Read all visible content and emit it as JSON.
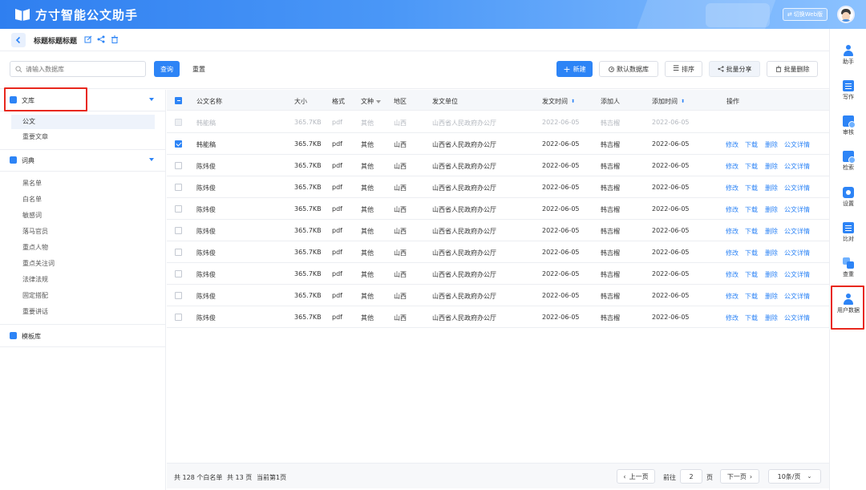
{
  "header": {
    "app_title": "方寸智能公文助手",
    "switch_label": "切换Web版"
  },
  "titlebar": {
    "title": "标题标题标题"
  },
  "toolbar": {
    "search_placeholder": "请输入数据库",
    "query_label": "查询",
    "reset_label": "重置",
    "new_label": "新建",
    "default_db_label": "默认数据库",
    "sort_label": "排序",
    "batch_share_label": "批量分享",
    "batch_delete_label": "批量删除"
  },
  "sidebar": {
    "library": {
      "label": "文库",
      "items": [
        "公文",
        "重要文章"
      ]
    },
    "dictionary": {
      "label": "词典",
      "items": [
        "黑名单",
        "白名单",
        "敏感词",
        "落马官员",
        "重点人物",
        "重点关注词",
        "法律法规",
        "固定搭配",
        "重要讲话"
      ]
    },
    "template": {
      "label": "模板库"
    }
  },
  "table": {
    "headers": {
      "name": "公文名称",
      "size": "大小",
      "format": "格式",
      "type": "文种",
      "region": "地区",
      "unit": "发文单位",
      "send_time": "发文时间",
      "adder": "添加人",
      "add_time": "添加时间",
      "ops": "操作"
    },
    "ops": {
      "edit": "修改",
      "download": "下载",
      "delete": "删除",
      "detail": "公文详情"
    },
    "rows": [
      {
        "name": "韩能稿",
        "size": "365.7KB",
        "format": "pdf",
        "type": "其他",
        "region": "山西",
        "unit": "山西省人民政府办公厅",
        "send_time": "2022-06-05",
        "adder": "韩吉榴",
        "add_time": "2022-06-05",
        "state": "disabled"
      },
      {
        "name": "韩能稿",
        "size": "365.7KB",
        "format": "pdf",
        "type": "其他",
        "region": "山西",
        "unit": "山西省人民政府办公厅",
        "send_time": "2022-06-05",
        "adder": "韩吉榴",
        "add_time": "2022-06-05",
        "state": "checked"
      },
      {
        "name": "陈炜俊",
        "size": "365.7KB",
        "format": "pdf",
        "type": "其他",
        "region": "山西",
        "unit": "山西省人民政府办公厅",
        "send_time": "2022-06-05",
        "adder": "韩吉榴",
        "add_time": "2022-06-05",
        "state": "normal"
      },
      {
        "name": "陈炜俊",
        "size": "365.7KB",
        "format": "pdf",
        "type": "其他",
        "region": "山西",
        "unit": "山西省人民政府办公厅",
        "send_time": "2022-06-05",
        "adder": "韩吉榴",
        "add_time": "2022-06-05",
        "state": "normal"
      },
      {
        "name": "陈炜俊",
        "size": "365.7KB",
        "format": "pdf",
        "type": "其他",
        "region": "山西",
        "unit": "山西省人民政府办公厅",
        "send_time": "2022-06-05",
        "adder": "韩吉榴",
        "add_time": "2022-06-05",
        "state": "normal"
      },
      {
        "name": "陈炜俊",
        "size": "365.7KB",
        "format": "pdf",
        "type": "其他",
        "region": "山西",
        "unit": "山西省人民政府办公厅",
        "send_time": "2022-06-05",
        "adder": "韩吉榴",
        "add_time": "2022-06-05",
        "state": "normal"
      },
      {
        "name": "陈炜俊",
        "size": "365.7KB",
        "format": "pdf",
        "type": "其他",
        "region": "山西",
        "unit": "山西省人民政府办公厅",
        "send_time": "2022-06-05",
        "adder": "韩吉榴",
        "add_time": "2022-06-05",
        "state": "normal"
      },
      {
        "name": "陈炜俊",
        "size": "365.7KB",
        "format": "pdf",
        "type": "其他",
        "region": "山西",
        "unit": "山西省人民政府办公厅",
        "send_time": "2022-06-05",
        "adder": "韩吉榴",
        "add_time": "2022-06-05",
        "state": "normal"
      },
      {
        "name": "陈炜俊",
        "size": "365.7KB",
        "format": "pdf",
        "type": "其他",
        "region": "山西",
        "unit": "山西省人民政府办公厅",
        "send_time": "2022-06-05",
        "adder": "韩吉榴",
        "add_time": "2022-06-05",
        "state": "normal"
      },
      {
        "name": "陈炜俊",
        "size": "365.7KB",
        "format": "pdf",
        "type": "其他",
        "region": "山西",
        "unit": "山西省人民政府办公厅",
        "send_time": "2022-06-05",
        "adder": "韩吉榴",
        "add_time": "2022-06-05",
        "state": "normal"
      }
    ]
  },
  "footer": {
    "total_text": "共 128 个白名单",
    "pages_text": "共 13 页",
    "current_text": "当前第1页",
    "prev_label": "上一页",
    "goto_label": "前往",
    "page_input": "2",
    "page_unit": "页",
    "next_label": "下一页",
    "page_size": "10条/页"
  },
  "rightbar": {
    "items": [
      "助手",
      "写作",
      "审核",
      "检索",
      "设置",
      "比对",
      "查重",
      "用户数据"
    ]
  },
  "colors": {
    "accent": "#2d84f6",
    "highlight": "#e8281e"
  }
}
